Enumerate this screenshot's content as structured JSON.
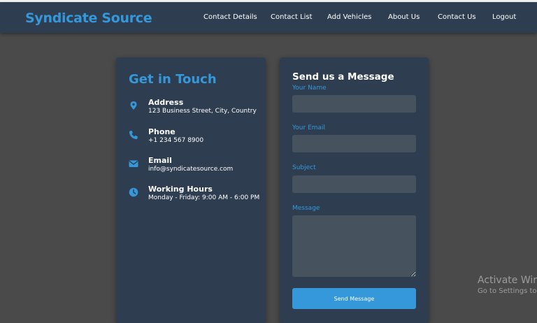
{
  "navbar": {
    "brand": "Syndicate Source",
    "links": [
      "Contact Details",
      "Contact List",
      "Add Vehicles",
      "About Us",
      "Contact Us",
      "Logout"
    ]
  },
  "info": {
    "title": "Get in Touch",
    "items": [
      {
        "icon": "map-marker-icon",
        "label": "Address",
        "value": "123 Business Street, City, Country"
      },
      {
        "icon": "phone-icon",
        "label": "Phone",
        "value": "+1 234 567 8900"
      },
      {
        "icon": "envelope-icon",
        "label": "Email",
        "value": "info@syndicatesource.com"
      },
      {
        "icon": "clock-icon",
        "label": "Working Hours",
        "value": "Monday - Friday: 9:00 AM - 6:00 PM"
      }
    ]
  },
  "form": {
    "title": "Send us a Message",
    "name_label": "Your Name",
    "name_value": "",
    "email_label": "Your Email",
    "email_value": "",
    "subject_label": "Subject",
    "subject_value": "",
    "message_label": "Message",
    "message_value": "",
    "submit_label": "Send Message"
  },
  "watermark": {
    "title": "Activate Windows",
    "subtitle": "Go to Settings to activate Windows."
  },
  "colors": {
    "accent": "#3498db",
    "navbar_bg": "#2e3e50",
    "card_bg": "#2e3e50",
    "input_bg": "#46535f",
    "page_bg": "#4a4a4a"
  }
}
